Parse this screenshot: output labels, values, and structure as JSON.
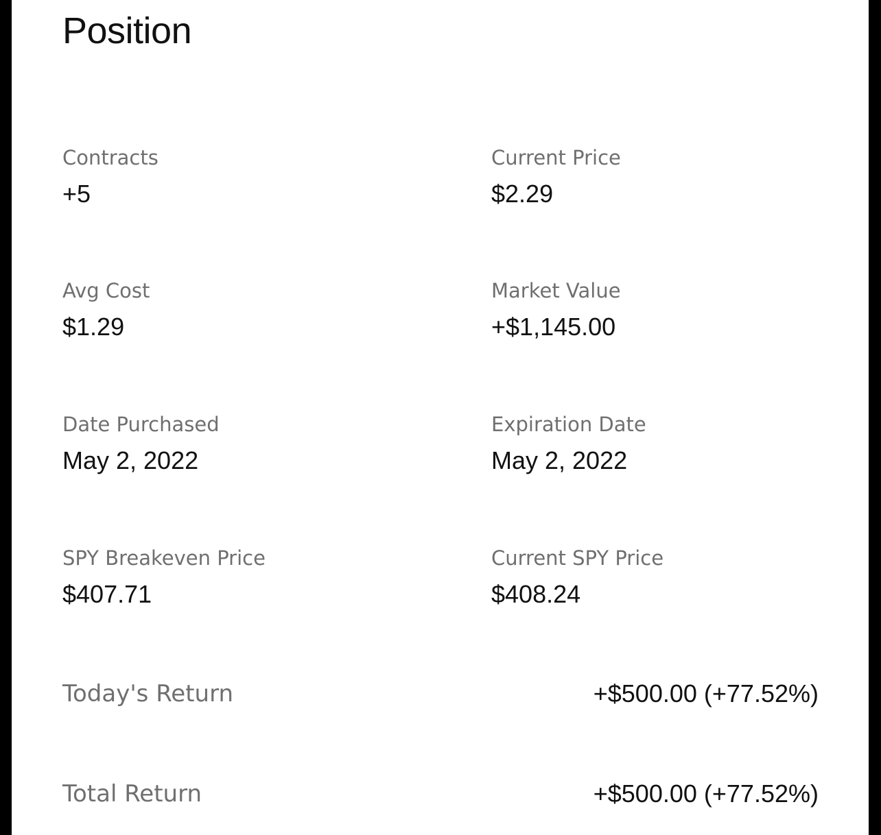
{
  "title": "Position",
  "fields": {
    "contracts": {
      "label": "Contracts",
      "value": "+5"
    },
    "current_price": {
      "label": "Current Price",
      "value": "$2.29"
    },
    "avg_cost": {
      "label": "Avg Cost",
      "value": "$1.29"
    },
    "market_value": {
      "label": "Market Value",
      "value": "+$1,145.00"
    },
    "date_purchased": {
      "label": "Date Purchased",
      "value": "May 2, 2022"
    },
    "expiration_date": {
      "label": "Expiration Date",
      "value": "May 2, 2022"
    },
    "breakeven": {
      "label": "SPY Breakeven Price",
      "value": "$407.71"
    },
    "current_spy": {
      "label": "Current SPY Price",
      "value": "$408.24"
    }
  },
  "returns": {
    "today": {
      "label": "Today's Return",
      "value": "+$500.00 (+77.52%)"
    },
    "total": {
      "label": "Total Return",
      "value": "+$500.00 (+77.52%)"
    }
  },
  "colors": {
    "background": "#ffffff",
    "frame": "#000000",
    "label": "#6f6f6f",
    "value": "#111111"
  }
}
